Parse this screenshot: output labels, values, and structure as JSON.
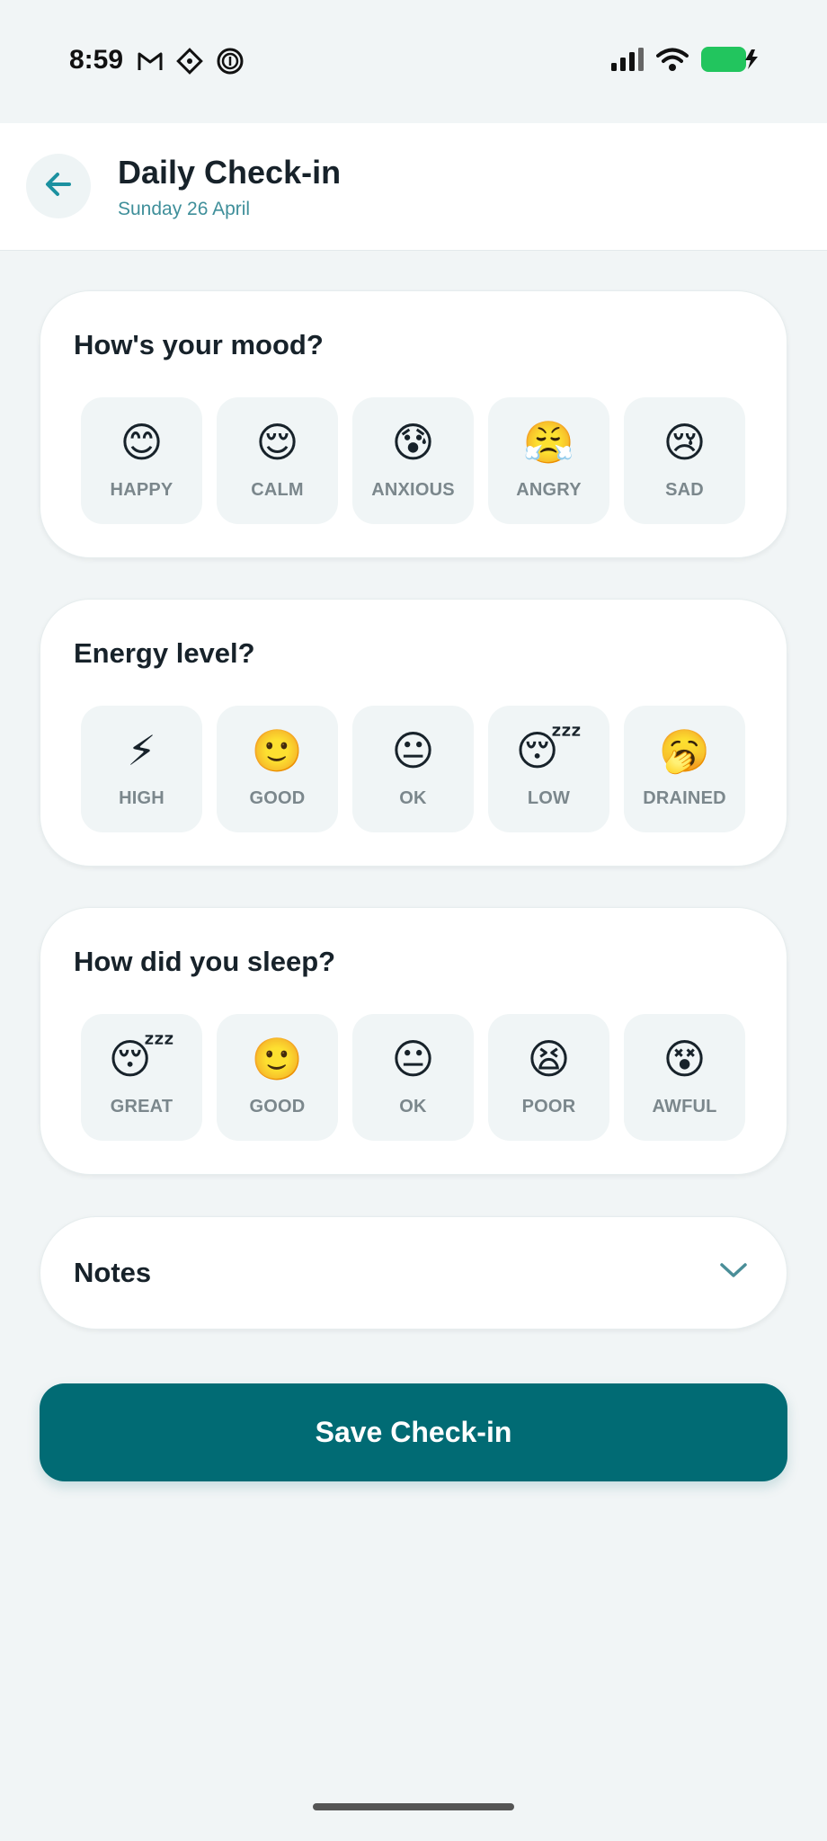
{
  "status": {
    "time": "8:59",
    "left_icons": [
      "gmail-icon",
      "diamond-icon",
      "fingerprint-icon"
    ],
    "right_icons": [
      "signal-icon",
      "wifi-icon",
      "battery-charging-icon"
    ]
  },
  "header": {
    "title": "Daily Check-in",
    "date": "Sunday 26 April",
    "back_icon": "arrow-left-icon"
  },
  "sections": [
    {
      "title": "How's your mood?",
      "options": [
        {
          "emoji": "😊",
          "label": "HAPPY"
        },
        {
          "emoji": "😌",
          "label": "CALM"
        },
        {
          "emoji": "😰",
          "label": "ANXIOUS"
        },
        {
          "emoji": "😤",
          "label": "ANGRY"
        },
        {
          "emoji": "😢",
          "label": "SAD"
        }
      ]
    },
    {
      "title": "Energy level?",
      "options": [
        {
          "emoji": "⚡",
          "label": "HIGH"
        },
        {
          "emoji": "🙂",
          "label": "GOOD"
        },
        {
          "emoji": "😐",
          "label": "OK"
        },
        {
          "emoji": "😴",
          "label": "LOW"
        },
        {
          "emoji": "🥱",
          "label": "DRAINED"
        }
      ]
    },
    {
      "title": "How did you sleep?",
      "options": [
        {
          "emoji": "😴",
          "label": "GREAT"
        },
        {
          "emoji": "🙂",
          "label": "GOOD"
        },
        {
          "emoji": "😐",
          "label": "OK"
        },
        {
          "emoji": "😫",
          "label": "POOR"
        },
        {
          "emoji": "😵",
          "label": "AWFUL"
        }
      ]
    }
  ],
  "notes": {
    "title": "Notes",
    "icon": "chevron-down-icon"
  },
  "save_button": {
    "label": "Save Check-in"
  },
  "colors": {
    "accent": "#016b74",
    "link": "#3f8f9a",
    "background": "#f1f5f6"
  }
}
